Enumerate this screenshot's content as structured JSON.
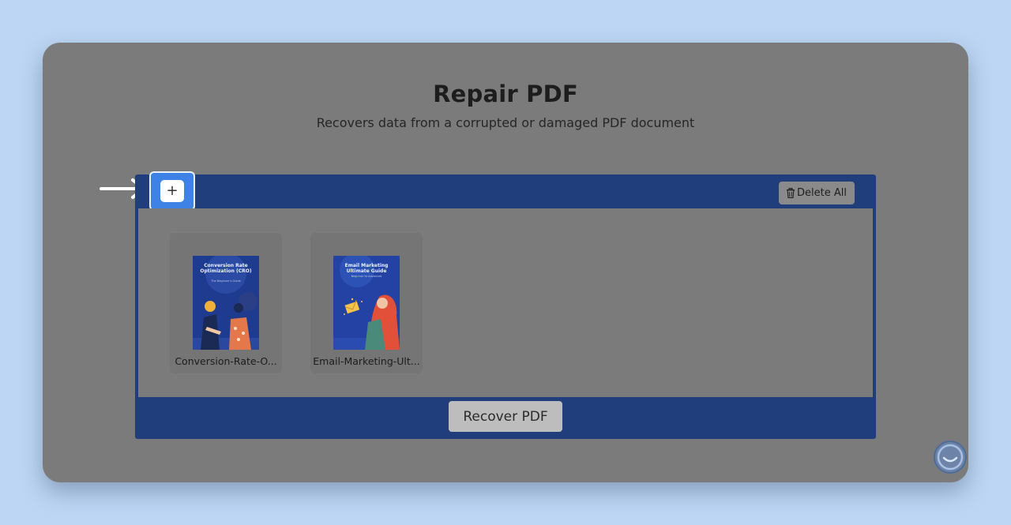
{
  "page": {
    "title": "Repair PDF",
    "subtitle": "Recovers data from a corrupted or damaged PDF document"
  },
  "toolbar": {
    "add_label": "+",
    "delete_all_label": "Delete All"
  },
  "files": [
    {
      "name": "Conversion-Rate-O...",
      "thumb_title": "Conversion Rate Optimization (CRO)",
      "thumb_sub": "The Beginner's Guide"
    },
    {
      "name": "Email-Marketing-Ult...",
      "thumb_title": "Email Marketing Ultimate Guide",
      "thumb_sub": "Beginner to Advanced"
    }
  ],
  "actions": {
    "recover_label": "Recover PDF"
  },
  "colors": {
    "background": "#bcd6f4",
    "overlay": "#7b7b7b",
    "panel": "#1f3e7b",
    "highlight": "#3d82e4"
  },
  "icons": {
    "pointer": "arrow-right-icon",
    "delete": "trash-icon",
    "chat": "chat-bubble-icon"
  }
}
